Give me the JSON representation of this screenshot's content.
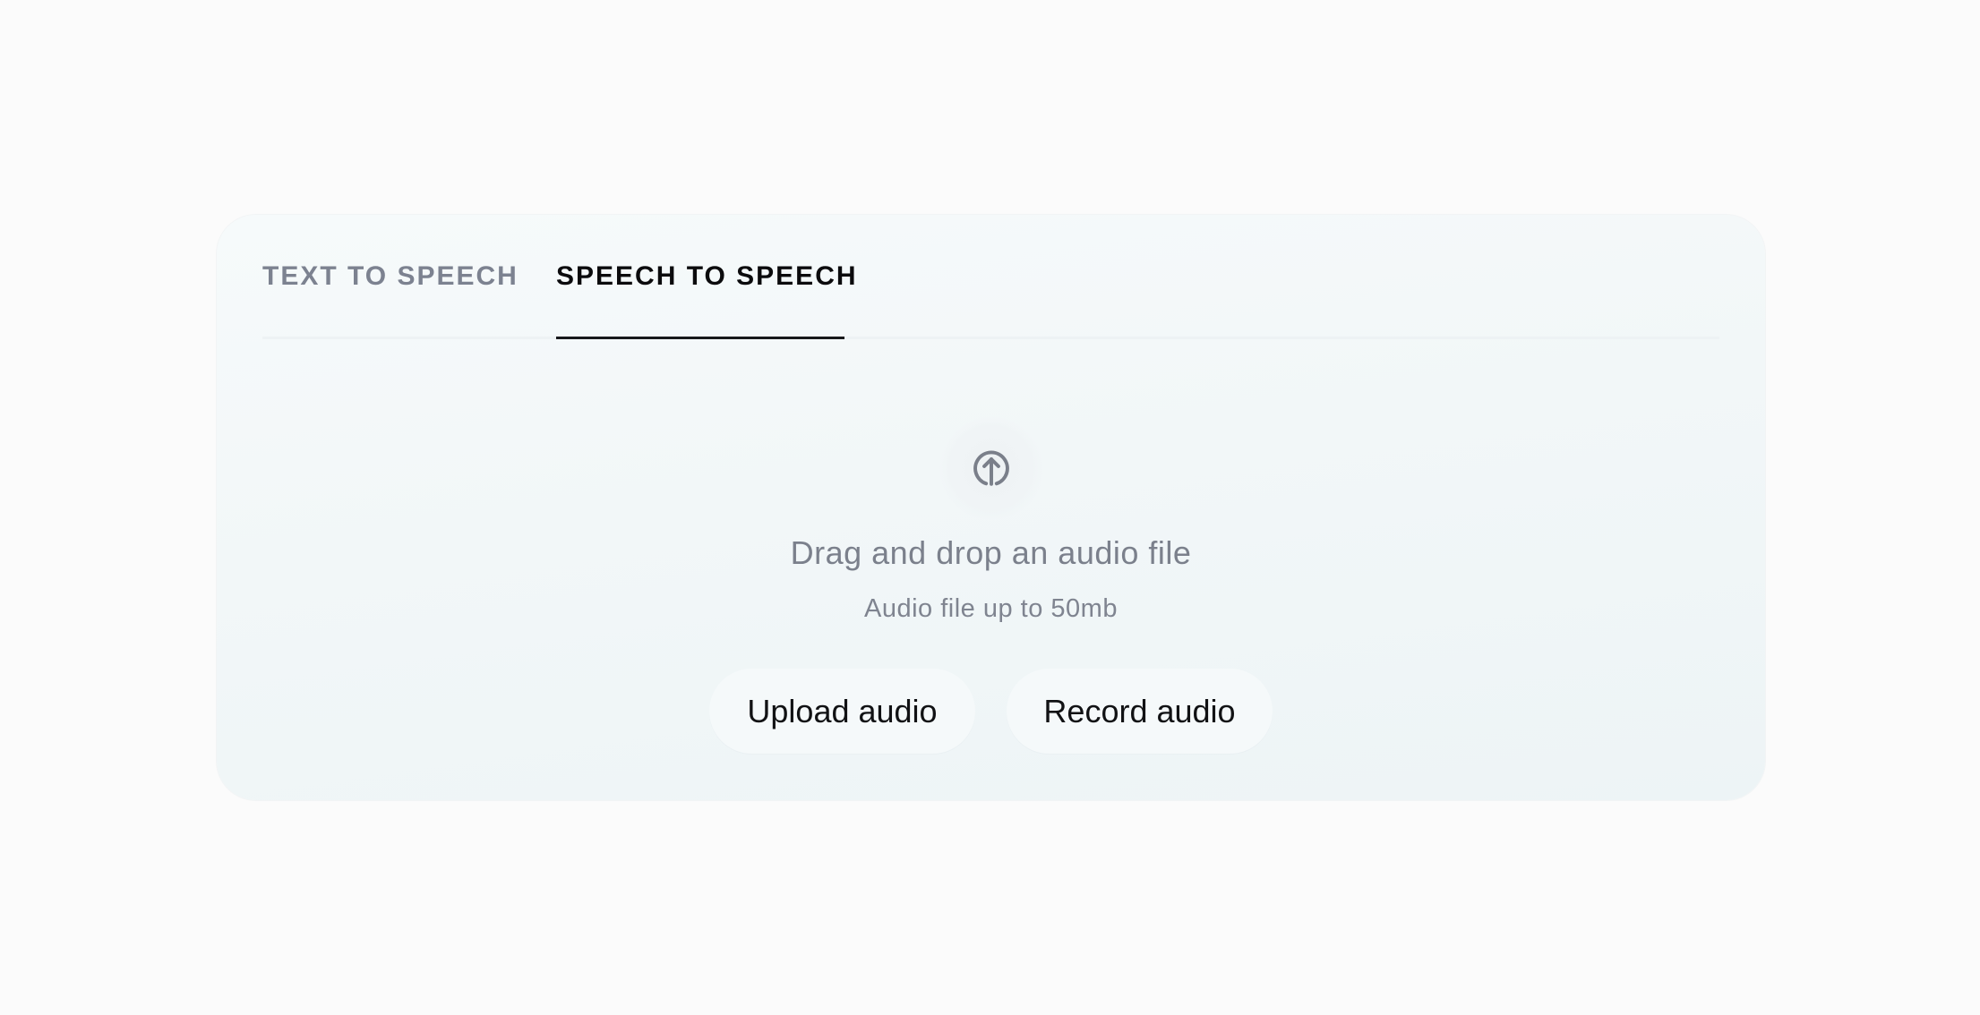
{
  "tabs": [
    {
      "label": "TEXT TO SPEECH",
      "active": false
    },
    {
      "label": "SPEECH TO SPEECH",
      "active": true
    }
  ],
  "dropzone": {
    "icon": "upload-arrow-circle-icon",
    "headline": "Drag and drop an audio file",
    "subline": "Audio file up to 50mb"
  },
  "actions": {
    "upload_label": "Upload audio",
    "record_label": "Record audio"
  },
  "colors": {
    "page_background": "#fbfbfb",
    "card_background": "#f2f7f8",
    "active_tab_text": "#0b0b0d",
    "inactive_tab_text": "#7c8290",
    "muted_text": "#7b808c"
  }
}
